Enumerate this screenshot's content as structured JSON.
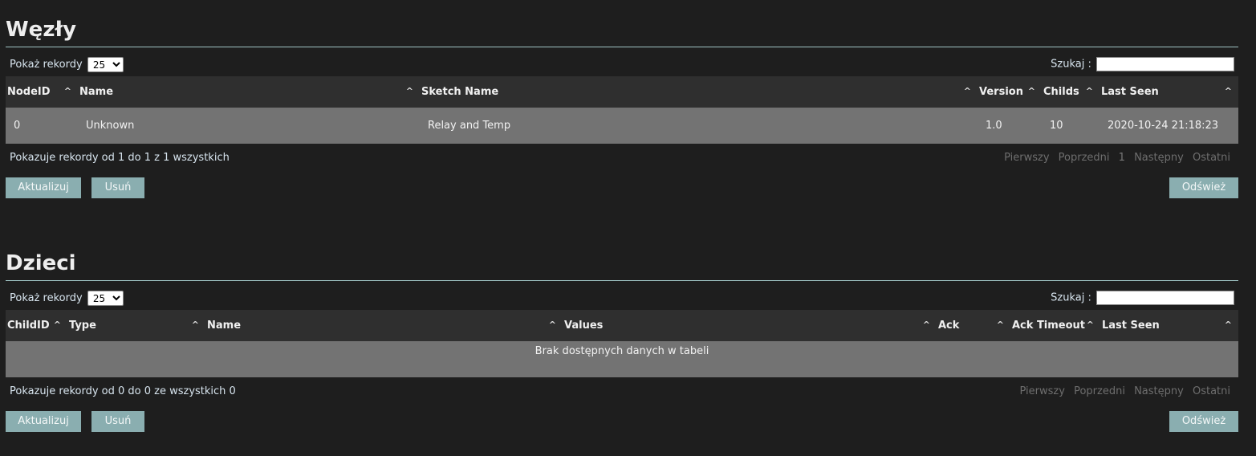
{
  "nodes": {
    "title": "Węzły",
    "length_label": "Pokaż rekordy",
    "length_value": "25",
    "search_label": "Szukaj :",
    "columns": [
      "NodeID",
      "Name",
      "Sketch Name",
      "Version",
      "Childs",
      "Last Seen"
    ],
    "rows": [
      {
        "nodeid": "0",
        "name": "Unknown",
        "sketch": "Relay and Temp",
        "version": "1.0",
        "childs": "10",
        "lastseen": "2020-10-24 21:18:23"
      }
    ],
    "info": "Pokazuje rekordy od 1 do 1 z 1 wszystkich",
    "paging": {
      "first": "Pierwszy",
      "prev": "Poprzedni",
      "page": "1",
      "next": "Następny",
      "last": "Ostatni"
    },
    "buttons": {
      "update": "Aktualizuj",
      "delete": "Usuń",
      "refresh": "Odśwież"
    }
  },
  "children": {
    "title": "Dzieci",
    "length_label": "Pokaż rekordy",
    "length_value": "25",
    "search_label": "Szukaj :",
    "columns": [
      "ChildID",
      "Type",
      "Name",
      "Values",
      "Ack",
      "Ack Timeout",
      "Last Seen"
    ],
    "empty_text": "Brak dostępnych danych w tabeli",
    "info": "Pokazuje rekordy od 0 do 0 ze wszystkich 0",
    "paging": {
      "first": "Pierwszy",
      "prev": "Poprzedni",
      "next": "Następny",
      "last": "Ostatni"
    },
    "buttons": {
      "update": "Aktualizuj",
      "delete": "Usuń",
      "refresh": "Odśwież"
    }
  },
  "icons": {
    "sort": "sort-up-icon"
  },
  "colors": {
    "background": "#1e1e1e",
    "header": "#2f2f2f",
    "row": "#737373",
    "button": "#8aaeb0",
    "rule": "#9fc3c3"
  }
}
